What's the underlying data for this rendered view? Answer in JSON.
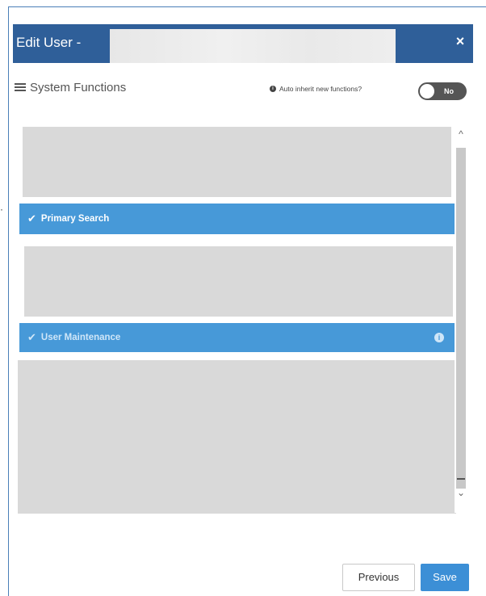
{
  "dialog": {
    "title": "Edit User - ",
    "close_icon": "close-icon",
    "close_glyph": "×"
  },
  "section": {
    "title": "System Functions",
    "icon": "list-icon"
  },
  "auto_inherit": {
    "label": "Auto inherit new functions?",
    "icon": "info-icon",
    "toggle_value": "No"
  },
  "functions": [
    {
      "label": "Primary Search",
      "selected": true
    },
    {
      "label": "User Maintenance",
      "selected": true,
      "dimmed": true,
      "info_icon": "info-icon"
    }
  ],
  "scrollbar": {
    "up_icon": "chevron-up-icon",
    "down_icon": "chevron-down-icon"
  },
  "buttons": {
    "previous": "Previous",
    "save": "Save"
  },
  "colors": {
    "header": "#2f5f99",
    "row_selected": "#4799d8",
    "save_button": "#3c8fd6",
    "placeholder_block": "#d9d9d9"
  }
}
